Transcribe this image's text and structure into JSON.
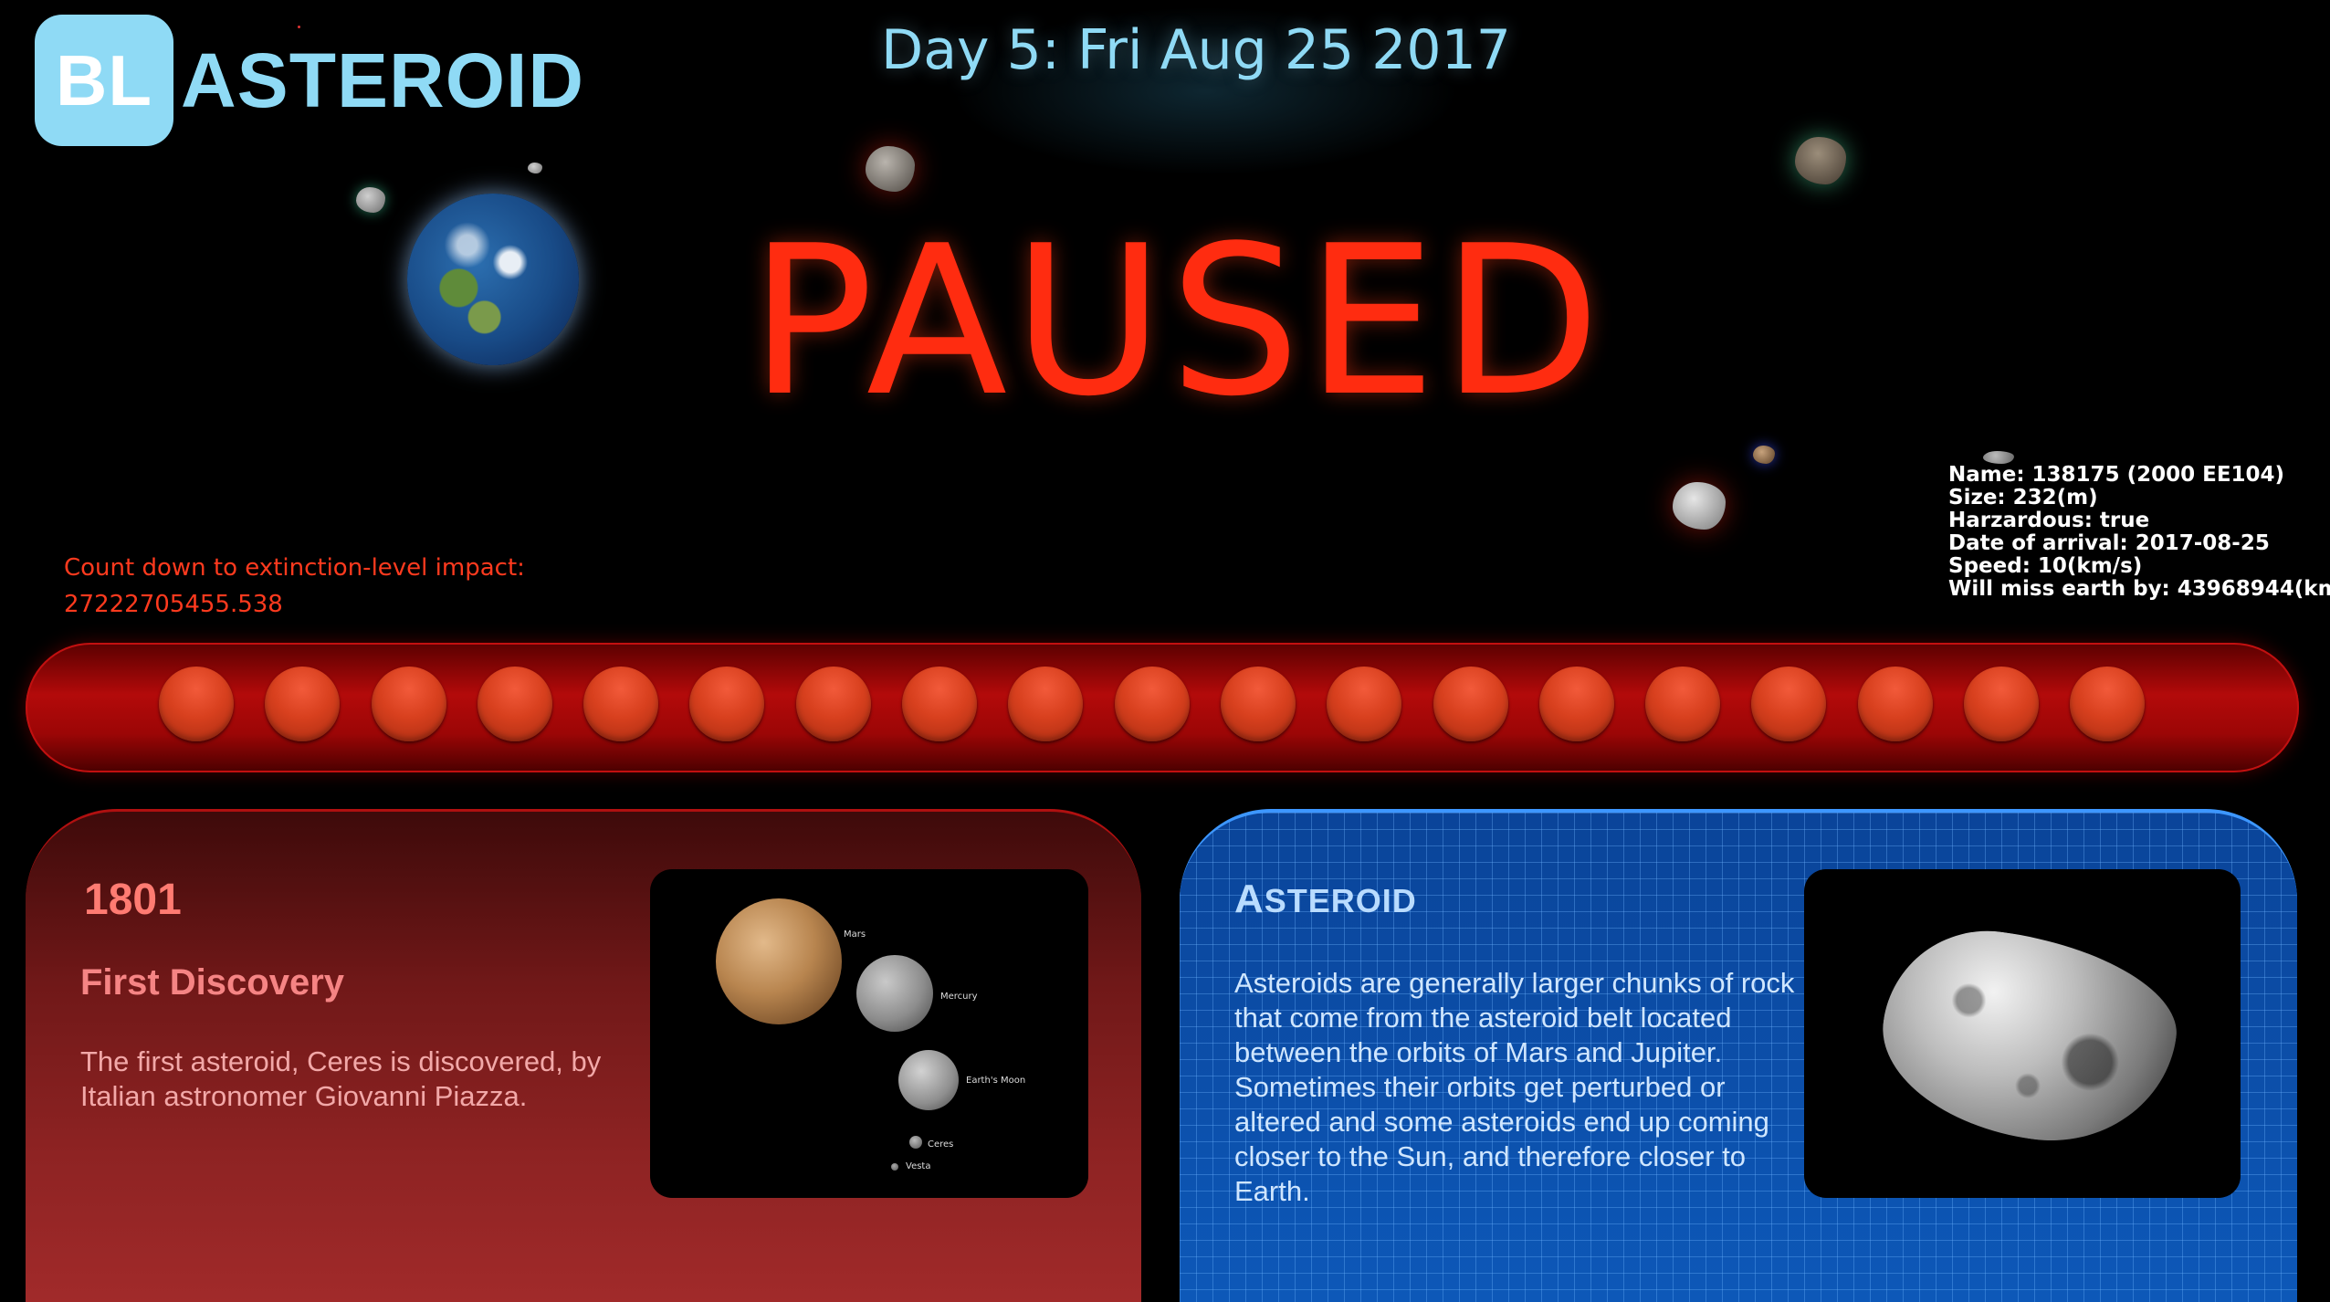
{
  "header": {
    "logo_badge": "BL",
    "logo_text": "ASTEROID",
    "day_title": "Day 5: Fri Aug 25 2017"
  },
  "status": {
    "paused_text": "PAUSED"
  },
  "countdown": {
    "label": "Count down to extinction-level impact:",
    "value": "27222705455.538"
  },
  "asteroid_info": {
    "name_label": "Name:",
    "name_value": "138175 (2000 EE104)",
    "size_label": "Size:",
    "size_value": "232(m)",
    "hazardous_label": "Harzardous:",
    "hazardous_value": "true",
    "arrival_label": "Date of arrival:",
    "arrival_value": "2017-08-25",
    "speed_label": "Speed:",
    "speed_value": "10(km/s)",
    "miss_label": "Will miss earth by:",
    "miss_value": "43968944(km"
  },
  "timeline": {
    "dot_count": 19
  },
  "card_history": {
    "year": "1801",
    "subtitle": "First Discovery",
    "text": "The first asteroid, Ceres is discovered, by Italian astronomer Giovanni Piazza.",
    "image_labels": {
      "mars": "Mars",
      "mercury": "Mercury",
      "moon": "Earth's Moon",
      "ceres": "Ceres",
      "vesta": "Vesta"
    }
  },
  "card_info": {
    "title_first": "A",
    "title_rest": "STEROID",
    "text": "Asteroids are generally larger chunks of rock that come from the asteroid belt located between the orbits of Mars and Jupiter. Sometimes their orbits get perturbed or altered and some asteroids end up coming closer to the Sun, and therefore closer to Earth."
  },
  "colors": {
    "accent_cyan": "#8fdaf5",
    "paused_red": "#ff2c10",
    "timeline_red": "#b30a0a",
    "card_blue": "#0a4ea9"
  }
}
